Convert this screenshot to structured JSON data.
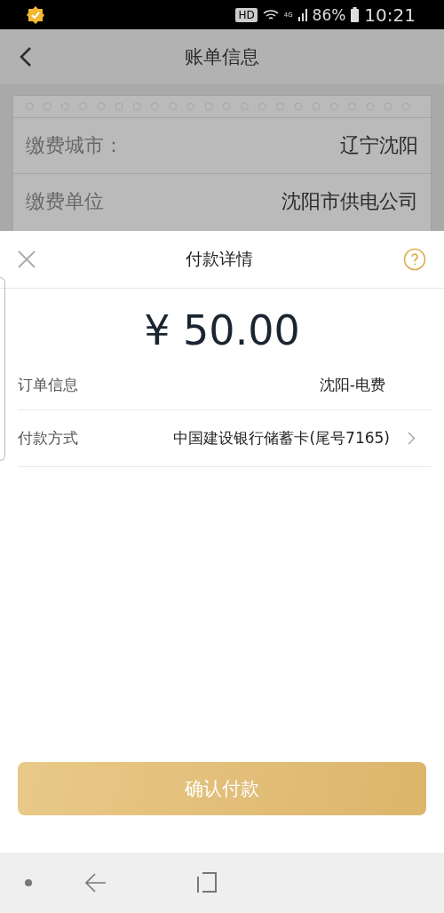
{
  "status_bar": {
    "hd": "HD",
    "network": "4G",
    "battery": "86%",
    "time": "10:21"
  },
  "header": {
    "title": "账单信息"
  },
  "bill": {
    "rows": [
      {
        "label": "缴费城市：",
        "value": "辽宁沈阳"
      },
      {
        "label": "缴费单位",
        "value": "沈阳市供电公司"
      }
    ]
  },
  "sheet": {
    "title": "付款详情",
    "amount": "¥ 50.00",
    "rows": [
      {
        "label": "订单信息",
        "value": "沈阳-电费",
        "chevron": false
      },
      {
        "label": "付款方式",
        "value": "中国建设银行储蓄卡(尾号7165)",
        "chevron": true
      }
    ],
    "confirm_button": "确认付款"
  }
}
